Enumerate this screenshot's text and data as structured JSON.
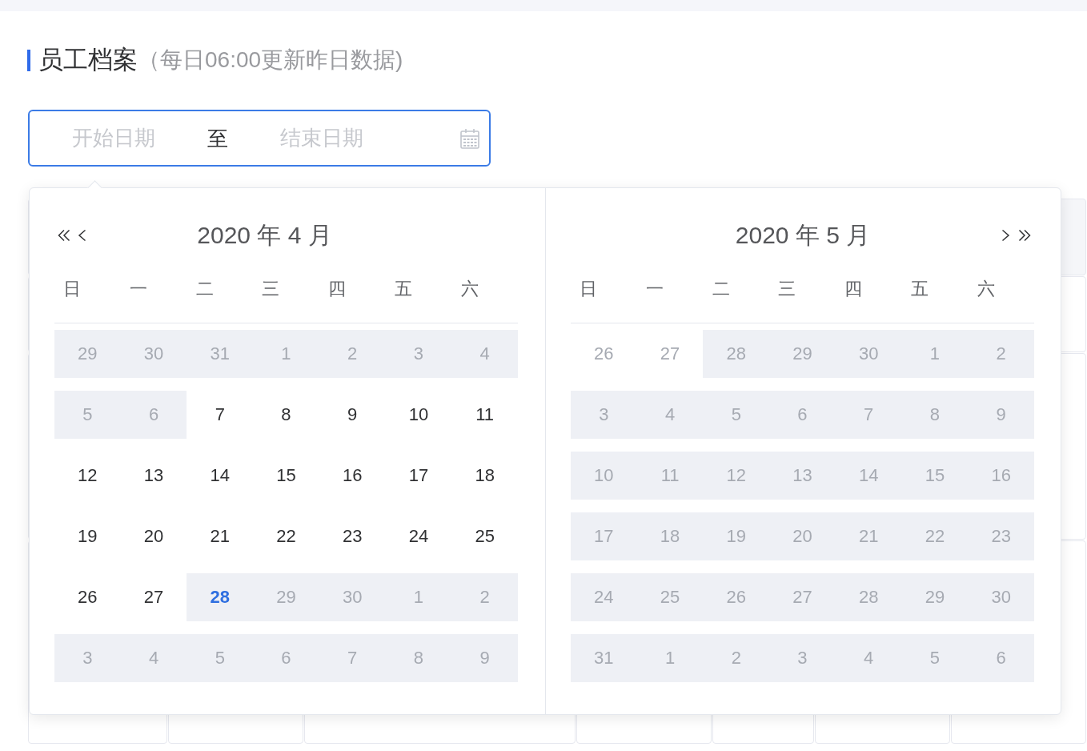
{
  "page_header": {
    "title": "员工档案",
    "note": "（每日06:00更新昨日数据)"
  },
  "date_range": {
    "focused": true,
    "start": {
      "placeholder": "开始日期"
    },
    "separator": "至",
    "end": {
      "placeholder": "结束日期"
    }
  },
  "date_picker": {
    "panels": [
      {
        "title": "2020 年 4 月",
        "weekdays": [
          "日",
          "一",
          "二",
          "三",
          "四",
          "五",
          "六"
        ],
        "weeks": [
          [
            {
              "day": "29",
              "muted": true,
              "disabled": true,
              "today": false
            },
            {
              "day": "30",
              "muted": true,
              "disabled": true,
              "today": false
            },
            {
              "day": "31",
              "muted": true,
              "disabled": true,
              "today": false
            },
            {
              "day": "1",
              "muted": true,
              "disabled": true,
              "today": false
            },
            {
              "day": "2",
              "muted": true,
              "disabled": true,
              "today": false
            },
            {
              "day": "3",
              "muted": true,
              "disabled": true,
              "today": false
            },
            {
              "day": "4",
              "muted": true,
              "disabled": true,
              "today": false
            }
          ],
          [
            {
              "day": "5",
              "muted": true,
              "disabled": true,
              "today": false
            },
            {
              "day": "6",
              "muted": true,
              "disabled": true,
              "today": false
            },
            {
              "day": "7",
              "muted": false,
              "disabled": false,
              "today": false
            },
            {
              "day": "8",
              "muted": false,
              "disabled": false,
              "today": false
            },
            {
              "day": "9",
              "muted": false,
              "disabled": false,
              "today": false
            },
            {
              "day": "10",
              "muted": false,
              "disabled": false,
              "today": false
            },
            {
              "day": "11",
              "muted": false,
              "disabled": false,
              "today": false
            }
          ],
          [
            {
              "day": "12",
              "muted": false,
              "disabled": false,
              "today": false
            },
            {
              "day": "13",
              "muted": false,
              "disabled": false,
              "today": false
            },
            {
              "day": "14",
              "muted": false,
              "disabled": false,
              "today": false
            },
            {
              "day": "15",
              "muted": false,
              "disabled": false,
              "today": false
            },
            {
              "day": "16",
              "muted": false,
              "disabled": false,
              "today": false
            },
            {
              "day": "17",
              "muted": false,
              "disabled": false,
              "today": false
            },
            {
              "day": "18",
              "muted": false,
              "disabled": false,
              "today": false
            }
          ],
          [
            {
              "day": "19",
              "muted": false,
              "disabled": false,
              "today": false
            },
            {
              "day": "20",
              "muted": false,
              "disabled": false,
              "today": false
            },
            {
              "day": "21",
              "muted": false,
              "disabled": false,
              "today": false
            },
            {
              "day": "22",
              "muted": false,
              "disabled": false,
              "today": false
            },
            {
              "day": "23",
              "muted": false,
              "disabled": false,
              "today": false
            },
            {
              "day": "24",
              "muted": false,
              "disabled": false,
              "today": false
            },
            {
              "day": "25",
              "muted": false,
              "disabled": false,
              "today": false
            }
          ],
          [
            {
              "day": "26",
              "muted": false,
              "disabled": false,
              "today": false
            },
            {
              "day": "27",
              "muted": false,
              "disabled": false,
              "today": false
            },
            {
              "day": "28",
              "muted": false,
              "disabled": true,
              "today": true
            },
            {
              "day": "29",
              "muted": true,
              "disabled": true,
              "today": false
            },
            {
              "day": "30",
              "muted": true,
              "disabled": true,
              "today": false
            },
            {
              "day": "1",
              "muted": true,
              "disabled": true,
              "today": false
            },
            {
              "day": "2",
              "muted": true,
              "disabled": true,
              "today": false
            }
          ],
          [
            {
              "day": "3",
              "muted": true,
              "disabled": true,
              "today": false
            },
            {
              "day": "4",
              "muted": true,
              "disabled": true,
              "today": false
            },
            {
              "day": "5",
              "muted": true,
              "disabled": true,
              "today": false
            },
            {
              "day": "6",
              "muted": true,
              "disabled": true,
              "today": false
            },
            {
              "day": "7",
              "muted": true,
              "disabled": true,
              "today": false
            },
            {
              "day": "8",
              "muted": true,
              "disabled": true,
              "today": false
            },
            {
              "day": "9",
              "muted": true,
              "disabled": true,
              "today": false
            }
          ]
        ]
      },
      {
        "title": "2020 年 5 月",
        "weekdays": [
          "日",
          "一",
          "二",
          "三",
          "四",
          "五",
          "六"
        ],
        "weeks": [
          [
            {
              "day": "26",
              "muted": true,
              "disabled": false,
              "today": false
            },
            {
              "day": "27",
              "muted": true,
              "disabled": false,
              "today": false
            },
            {
              "day": "28",
              "muted": true,
              "disabled": true,
              "today": false
            },
            {
              "day": "29",
              "muted": true,
              "disabled": true,
              "today": false
            },
            {
              "day": "30",
              "muted": true,
              "disabled": true,
              "today": false
            },
            {
              "day": "1",
              "muted": true,
              "disabled": true,
              "today": false
            },
            {
              "day": "2",
              "muted": true,
              "disabled": true,
              "today": false
            }
          ],
          [
            {
              "day": "3",
              "muted": true,
              "disabled": true,
              "today": false
            },
            {
              "day": "4",
              "muted": true,
              "disabled": true,
              "today": false
            },
            {
              "day": "5",
              "muted": true,
              "disabled": true,
              "today": false
            },
            {
              "day": "6",
              "muted": true,
              "disabled": true,
              "today": false
            },
            {
              "day": "7",
              "muted": true,
              "disabled": true,
              "today": false
            },
            {
              "day": "8",
              "muted": true,
              "disabled": true,
              "today": false
            },
            {
              "day": "9",
              "muted": true,
              "disabled": true,
              "today": false
            }
          ],
          [
            {
              "day": "10",
              "muted": true,
              "disabled": true,
              "today": false
            },
            {
              "day": "11",
              "muted": true,
              "disabled": true,
              "today": false
            },
            {
              "day": "12",
              "muted": true,
              "disabled": true,
              "today": false
            },
            {
              "day": "13",
              "muted": true,
              "disabled": true,
              "today": false
            },
            {
              "day": "14",
              "muted": true,
              "disabled": true,
              "today": false
            },
            {
              "day": "15",
              "muted": true,
              "disabled": true,
              "today": false
            },
            {
              "day": "16",
              "muted": true,
              "disabled": true,
              "today": false
            }
          ],
          [
            {
              "day": "17",
              "muted": true,
              "disabled": true,
              "today": false
            },
            {
              "day": "18",
              "muted": true,
              "disabled": true,
              "today": false
            },
            {
              "day": "19",
              "muted": true,
              "disabled": true,
              "today": false
            },
            {
              "day": "20",
              "muted": true,
              "disabled": true,
              "today": false
            },
            {
              "day": "21",
              "muted": true,
              "disabled": true,
              "today": false
            },
            {
              "day": "22",
              "muted": true,
              "disabled": true,
              "today": false
            },
            {
              "day": "23",
              "muted": true,
              "disabled": true,
              "today": false
            }
          ],
          [
            {
              "day": "24",
              "muted": true,
              "disabled": true,
              "today": false
            },
            {
              "day": "25",
              "muted": true,
              "disabled": true,
              "today": false
            },
            {
              "day": "26",
              "muted": true,
              "disabled": true,
              "today": false
            },
            {
              "day": "27",
              "muted": true,
              "disabled": true,
              "today": false
            },
            {
              "day": "28",
              "muted": true,
              "disabled": true,
              "today": false
            },
            {
              "day": "29",
              "muted": true,
              "disabled": true,
              "today": false
            },
            {
              "day": "30",
              "muted": true,
              "disabled": true,
              "today": false
            }
          ],
          [
            {
              "day": "31",
              "muted": true,
              "disabled": true,
              "today": false
            },
            {
              "day": "1",
              "muted": true,
              "disabled": true,
              "today": false
            },
            {
              "day": "2",
              "muted": true,
              "disabled": true,
              "today": false
            },
            {
              "day": "3",
              "muted": true,
              "disabled": true,
              "today": false
            },
            {
              "day": "4",
              "muted": true,
              "disabled": true,
              "today": false
            },
            {
              "day": "5",
              "muted": true,
              "disabled": true,
              "today": false
            },
            {
              "day": "6",
              "muted": true,
              "disabled": true,
              "today": false
            }
          ]
        ]
      }
    ]
  }
}
